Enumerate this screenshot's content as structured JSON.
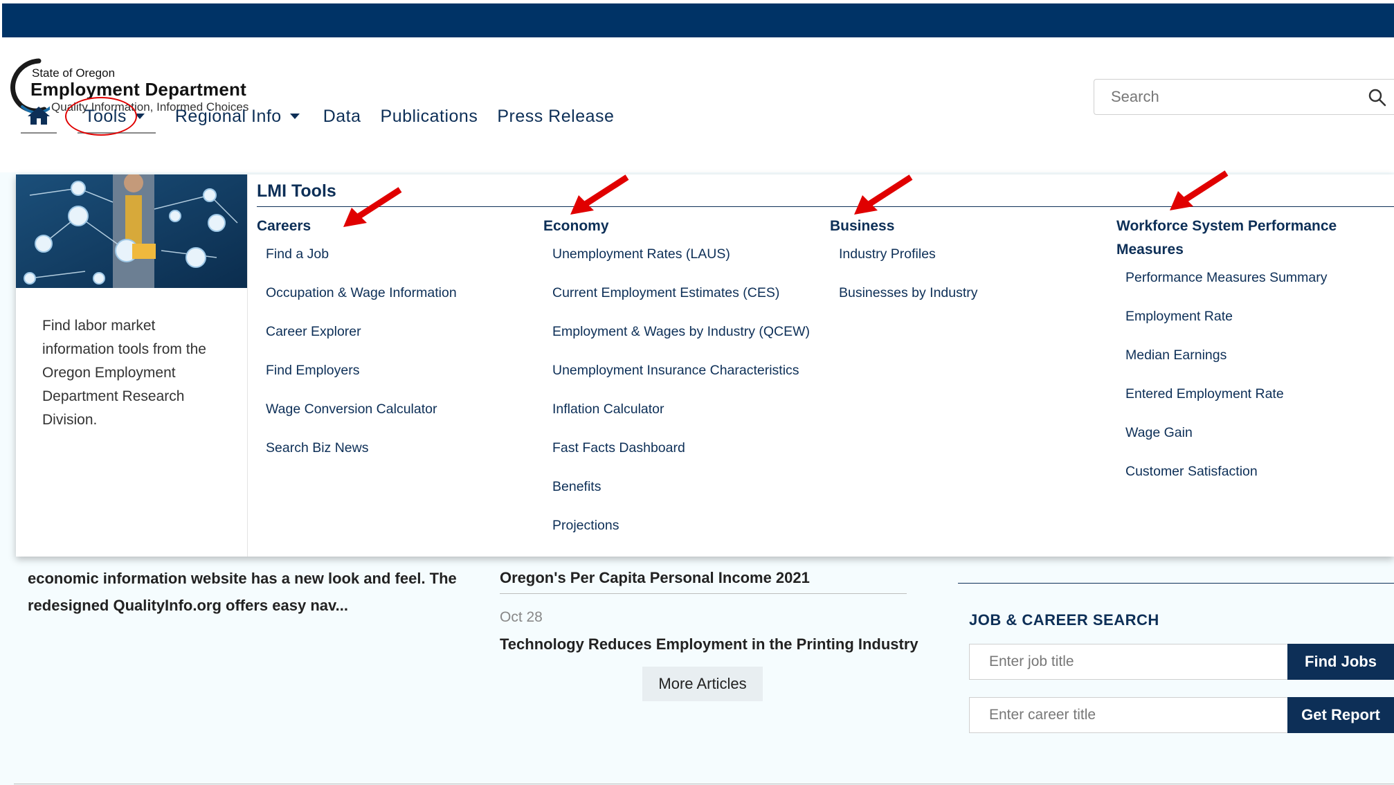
{
  "site": {
    "logo_line1": "State of Oregon",
    "logo_line2": "Employment Department",
    "logo_line3": "Quality Information, Informed Choices"
  },
  "search": {
    "placeholder": "Search",
    "icon": "magnifier-icon"
  },
  "nav": {
    "home_icon": "home-icon",
    "items": [
      {
        "label": "Tools",
        "has_dropdown": true,
        "active": true
      },
      {
        "label": "Regional Info",
        "has_dropdown": true
      },
      {
        "label": "Data"
      },
      {
        "label": "Publications"
      },
      {
        "label": "Press Release"
      }
    ]
  },
  "mega_menu": {
    "title": "LMI Tools",
    "description": "Find labor market information tools from the Oregon Employment Department Research Division.",
    "columns": [
      {
        "heading": "Careers",
        "links": [
          "Find a Job",
          "Occupation & Wage Information",
          "Career Explorer",
          "Find Employers",
          "Wage Conversion Calculator",
          "Search Biz News"
        ]
      },
      {
        "heading": "Economy",
        "links": [
          "Unemployment Rates (LAUS)",
          "Current Employment Estimates (CES)",
          "Employment & Wages by Industry (QCEW)",
          "Unemployment Insurance Characteristics",
          "Inflation Calculator",
          "Fast Facts Dashboard",
          "Benefits",
          "Projections"
        ]
      },
      {
        "heading": "Business",
        "links": [
          "Industry Profiles",
          "Businesses by Industry"
        ]
      },
      {
        "heading": "Workforce System Performance Measures",
        "links": [
          "Performance Measures Summary",
          "Employment Rate",
          "Median Earnings",
          "Entered Employment Rate",
          "Wage Gain",
          "Customer Satisfaction"
        ]
      }
    ]
  },
  "article": {
    "text": "economic information website has a new look and feel. The redesigned QualityInfo.org offers easy nav..."
  },
  "news": {
    "item1_title": "Oregon's Per Capita Personal Income 2021",
    "item2_date": "Oct 28",
    "item2_title": "Technology Reduces Employment in the Printing Industry",
    "more_button": "More Articles"
  },
  "job_search": {
    "heading": "JOB & CAREER SEARCH",
    "job_placeholder": "Enter job title",
    "job_button": "Find Jobs",
    "career_placeholder": "Enter career title",
    "career_button": "Get Report"
  },
  "colors": {
    "top_bar": "#003366",
    "nav_text": "#0d2f57",
    "annotation": "#e00000",
    "page_bg": "#f5fcfe"
  }
}
